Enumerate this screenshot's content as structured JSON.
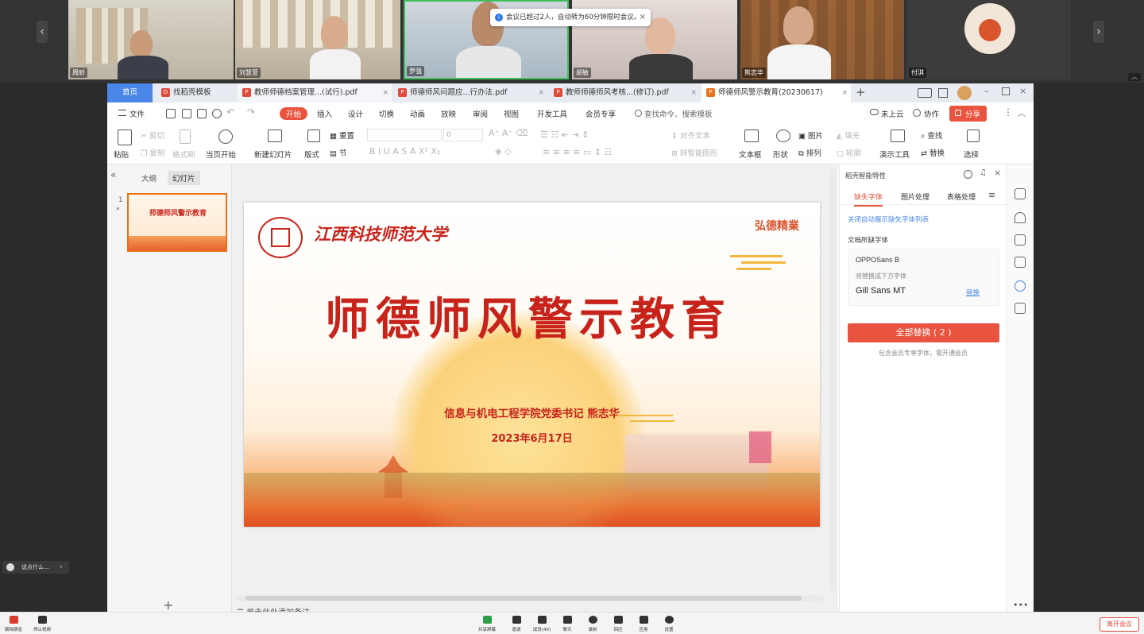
{
  "notice": {
    "text": "会议已超过2人，自动转为60分钟限时会议。"
  },
  "participants": [
    {
      "name": "周昕"
    },
    {
      "name": "刘慧萱"
    },
    {
      "name": "罗强"
    },
    {
      "name": "胡敏"
    },
    {
      "name": "熊志华"
    },
    {
      "name": "付淇"
    }
  ],
  "tabs": {
    "home": "首页",
    "t1": "找稻壳模板",
    "t2": "教师师德档案管理...(试行).pdf",
    "t3": "师德师风问题应...行办法.pdf",
    "t4": "教师师德师风考核...(修订).pdf",
    "t5": "师德师风警示教育(20230617)"
  },
  "menubar": {
    "file": "文件",
    "start": "开始",
    "insert": "插入",
    "design": "设计",
    "switch": "切换",
    "animation": "动画",
    "slideshow": "放映",
    "review": "审阅",
    "view": "视图",
    "dev": "开发工具",
    "member": "会员专享",
    "search": "查找命令、搜索模板",
    "cloud": "未上云",
    "collab": "协作",
    "share": "分享"
  },
  "ribbon": {
    "paste": "粘贴",
    "cut": "剪切",
    "copy": "复制",
    "format_brush": "格式刷",
    "from_current": "当页开始",
    "new_slide": "新建幻灯片",
    "layout": "版式",
    "reset": "重置",
    "section": "节",
    "font_size": "0",
    "align_text": "对齐文本",
    "to_smartart": "转智能图形",
    "textbox": "文本框",
    "shape": "形状",
    "picture": "图片",
    "arrange": "排列",
    "fill": "填充",
    "outline": "轮廓",
    "presenter_tools": "演示工具",
    "find": "查找",
    "replace": "替换",
    "select": "选择"
  },
  "left_panel": {
    "outline": "大纲",
    "slides": "幻灯片",
    "slide_number": "1"
  },
  "slide": {
    "university": "江西科技师范大学",
    "slogan": "弘德精業",
    "title": "师德师风警示教育",
    "speaker": "信息与机电工程学院党委书记 熊志华",
    "date": "2023年6月17日"
  },
  "notes_placeholder": "单击此处添加备注",
  "right_panel": {
    "title": "稻壳智能特性",
    "tabs": [
      "缺失字体",
      "图片处理",
      "表格处理"
    ],
    "link": "关闭自动展示缺失字体列表",
    "section_label": "文档所缺字体",
    "missing_font": "OPPOSans B",
    "replace_hint": "将替换成下方字体",
    "replacement_font": "Gill Sans MT",
    "replace_link": "替换",
    "replace_all": "全部替换 ( 2 )",
    "note": "包含会员专享字体，需开通会员"
  },
  "chat_pill": "说点什么...",
  "bottom_bar": {
    "mute": "解除静音",
    "video": "停止视频",
    "share_screen": "共享屏幕",
    "invite": "邀请",
    "members": "成员(40)",
    "chat": "聊天",
    "record": "录制",
    "playback": "回应",
    "apps": "应用",
    "settings": "设置",
    "leave": "离开会议"
  },
  "colors": {
    "accent_red": "#e8543f",
    "wps_blue": "#4a86e8",
    "title_red": "#c8231b"
  }
}
